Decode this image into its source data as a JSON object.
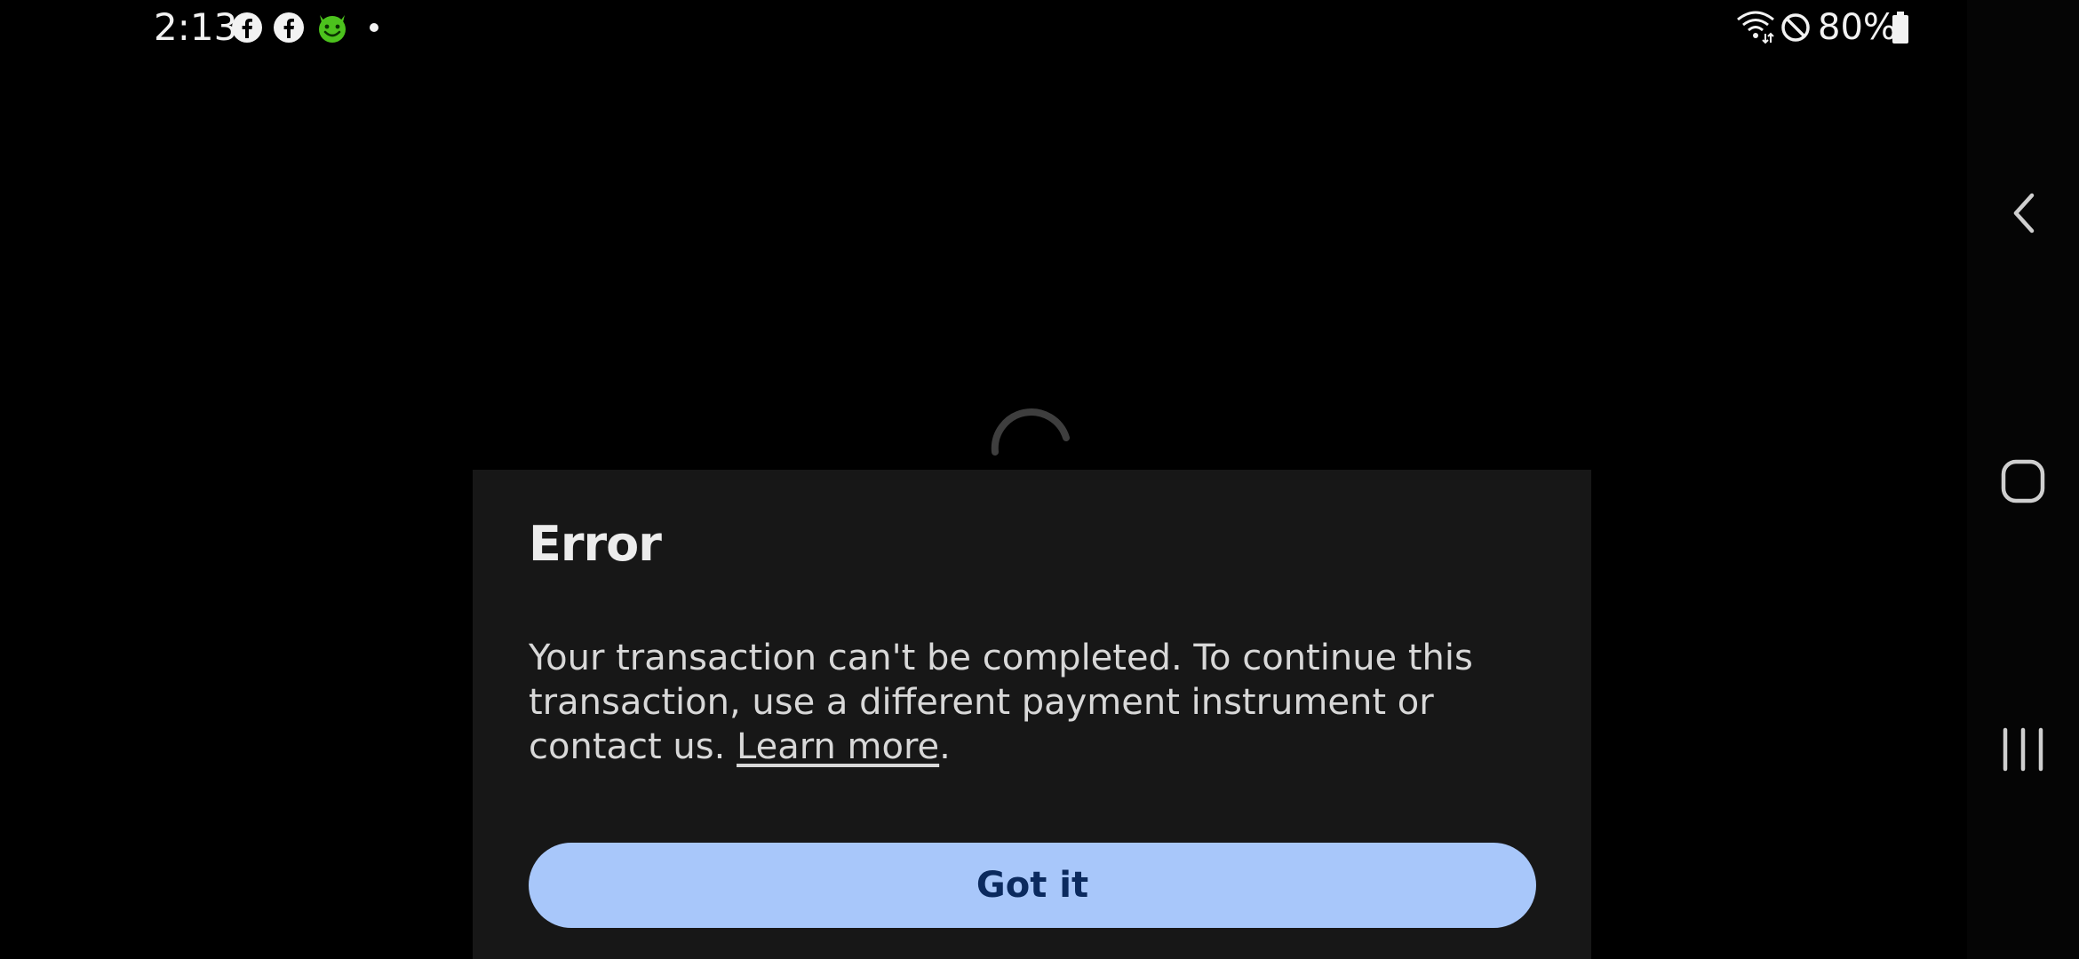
{
  "status_bar": {
    "time": "2:13",
    "notification_icons": [
      "facebook-icon",
      "facebook-icon",
      "happymod-icon",
      "dot-icon"
    ],
    "system_icons": [
      "wifi-icon",
      "do-not-disturb-icon",
      "battery-icon"
    ],
    "battery_percent": "80%"
  },
  "dialog": {
    "title": "Error",
    "message": "Your transaction can't be completed. To continue this transaction, use a different payment instrument or contact us.",
    "link_text": "Learn more",
    "link_suffix": ".",
    "button_label": "Got it"
  },
  "navigation": {
    "buttons": [
      "back-icon",
      "home-icon",
      "recents-icon"
    ]
  },
  "colors": {
    "background": "#000000",
    "dialog_background": "#171717",
    "button_background": "#a8c7fa",
    "button_text": "#0b2a5e",
    "happymod_green": "#4cc21d"
  }
}
